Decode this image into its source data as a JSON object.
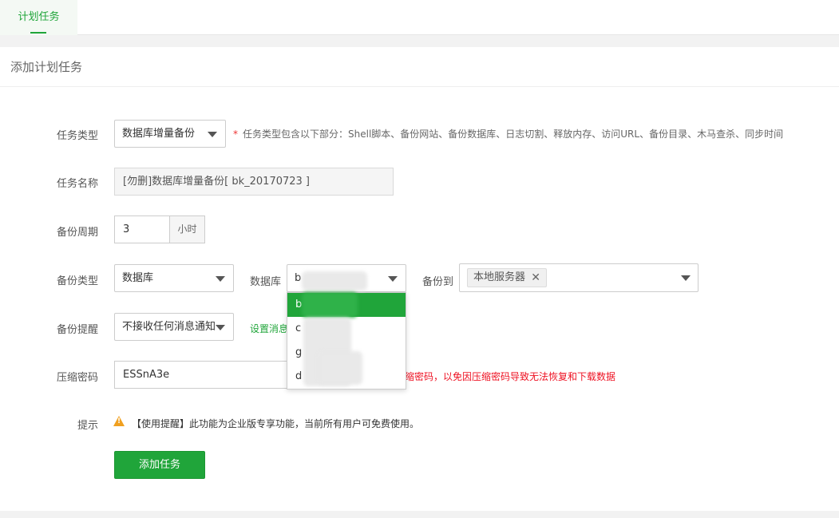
{
  "tabs": [
    {
      "label": "计划任务",
      "active": true
    }
  ],
  "panel": {
    "title": "添加计划任务"
  },
  "form": {
    "task_type": {
      "label": "任务类型",
      "value": "数据库增量备份",
      "hint_star": "*",
      "hint": "任务类型包含以下部分：Shell脚本、备份网站、备份数据库、日志切割、释放内存、访问URL、备份目录、木马查杀、同步时间"
    },
    "task_name": {
      "label": "任务名称",
      "value": "[勿删]数据库增量备份[ bk_20170723 ]"
    },
    "backup_cycle": {
      "label": "备份周期",
      "value": "3",
      "unit": "小时"
    },
    "backup_type": {
      "label": "备份类型",
      "value": "数据库",
      "database_label": "数据库",
      "database_value": "b",
      "backup_to_label": "备份到",
      "backup_to_tag": "本地服务器",
      "database_options": [
        "b",
        "c",
        "g",
        "d"
      ]
    },
    "backup_notify": {
      "label": "备份提醒",
      "value": "不接收任何消息通知",
      "settings_link": "设置消息"
    },
    "compress_password": {
      "label": "压缩密码",
      "value": "ESSnA3e",
      "hint": "缩密码，以免因压缩密码导致无法恢复和下载数据"
    },
    "tip": {
      "label": "提示",
      "icon_mark": "!",
      "text": "【使用提醒】此功能为企业版专享功能，当前所有用户可免费使用。"
    },
    "submit_label": "添加任务"
  },
  "colors": {
    "brand": "#20a53a",
    "warning": "#f0a020",
    "error": "#e12"
  }
}
